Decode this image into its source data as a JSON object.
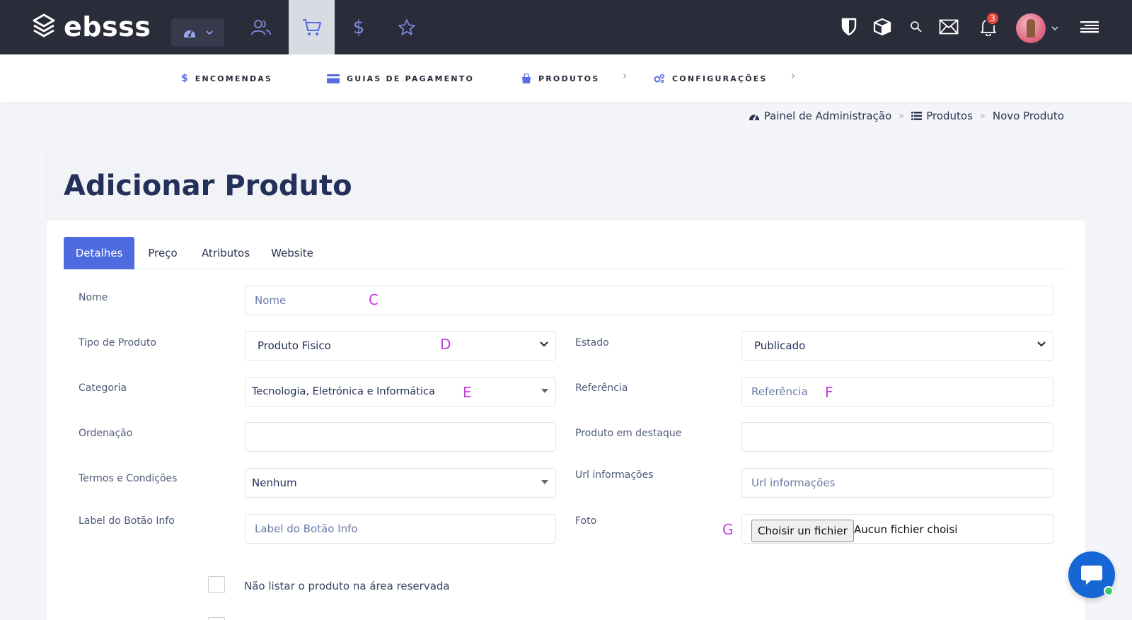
{
  "app": {
    "name": "ebsss"
  },
  "topbar": {
    "notification_count": "3"
  },
  "subnav": {
    "items": [
      {
        "label": "ENCOMENDAS",
        "icon": "dollar-icon"
      },
      {
        "label": "GUIAS DE PAGAMENTO",
        "icon": "credit-card-icon"
      },
      {
        "label": "PRODUTOS",
        "icon": "shopping-bag-icon"
      },
      {
        "label": "CONFIGURAÇÕES",
        "icon": "cogs-icon"
      }
    ]
  },
  "breadcrumb": {
    "items": [
      "Painel de Administração",
      "Produtos",
      "Novo Produto"
    ]
  },
  "page": {
    "title": "Adicionar Produto"
  },
  "tabs": [
    "Detalhes",
    "Preço",
    "Atributos",
    "Website"
  ],
  "form": {
    "nome": {
      "label": "Nome",
      "placeholder": "Nome"
    },
    "tipo": {
      "label": "Tipo de Produto",
      "value": "Produto Fisico"
    },
    "estado": {
      "label": "Estado",
      "value": "Publicado"
    },
    "categoria": {
      "label": "Categoria",
      "value": "Tecnologia, Eletrónica e Informática"
    },
    "referencia": {
      "label": "Referência",
      "placeholder": "Referência"
    },
    "ordenacao": {
      "label": "Ordenação",
      "value": ""
    },
    "destaque": {
      "label": "Produto em destaque",
      "value": ""
    },
    "termos": {
      "label": "Termos e Condições",
      "value": "Nenhum"
    },
    "url": {
      "label": "Url informações",
      "placeholder": "Url informações"
    },
    "botao": {
      "label": "Label do Botão Info",
      "placeholder": "Label do Botão Info"
    },
    "foto": {
      "label": "Foto",
      "button": "Choisir un fichier",
      "status": "Aucun fichier choisi"
    },
    "nao_listar": {
      "label": "Não listar o produto na área reservada"
    }
  },
  "annotations": [
    "C",
    "D",
    "E",
    "F",
    "G"
  ],
  "colors": {
    "topbar": "#2b2c3a",
    "accent": "#4f6be0",
    "annotation": "#c63be0",
    "chat": "#1766d6"
  }
}
